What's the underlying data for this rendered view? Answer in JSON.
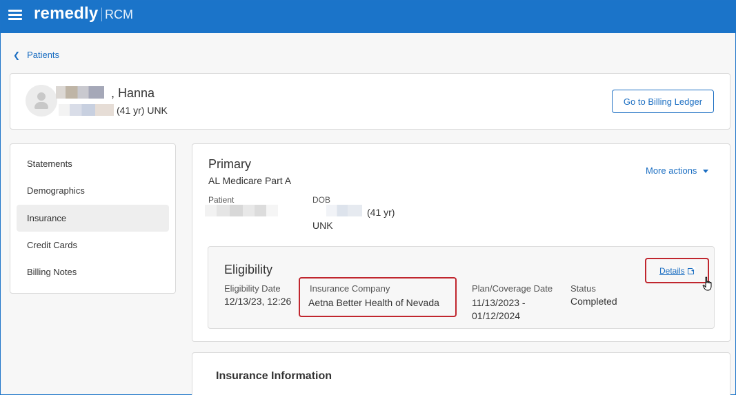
{
  "app": {
    "brand": "remedly",
    "product": "RCM"
  },
  "breadcrumb": {
    "back_label": "Patients"
  },
  "patient": {
    "name_suffix": ", Hanna",
    "meta": "(41 yr) UNK",
    "ledger_button": "Go to Billing Ledger"
  },
  "sidebar": {
    "items": [
      {
        "label": "Statements"
      },
      {
        "label": "Demographics"
      },
      {
        "label": "Insurance",
        "active": true
      },
      {
        "label": "Credit Cards"
      },
      {
        "label": "Billing Notes"
      }
    ]
  },
  "insurance": {
    "title": "Primary",
    "plan": "AL Medicare Part A",
    "more_actions": "More actions",
    "patient_label": "Patient",
    "dob_label": "DOB",
    "dob_age": "(41 yr)",
    "sex": "UNK"
  },
  "eligibility": {
    "title": "Eligibility",
    "details_link": "Details",
    "date_label": "Eligibility Date",
    "date_value": "12/13/23, 12:26",
    "company_label": "Insurance Company",
    "company_value": "Aetna Better Health of Nevada",
    "plan_label": "Plan/Coverage Date",
    "plan_value_line1": "11/13/2023 -",
    "plan_value_line2": "01/12/2024",
    "status_label": "Status",
    "status_value": "Completed"
  },
  "insurance_info": {
    "title": "Insurance Information"
  },
  "colors": {
    "accent": "#1b74c9",
    "link": "#1b6ec2",
    "highlight": "#c0262e"
  }
}
